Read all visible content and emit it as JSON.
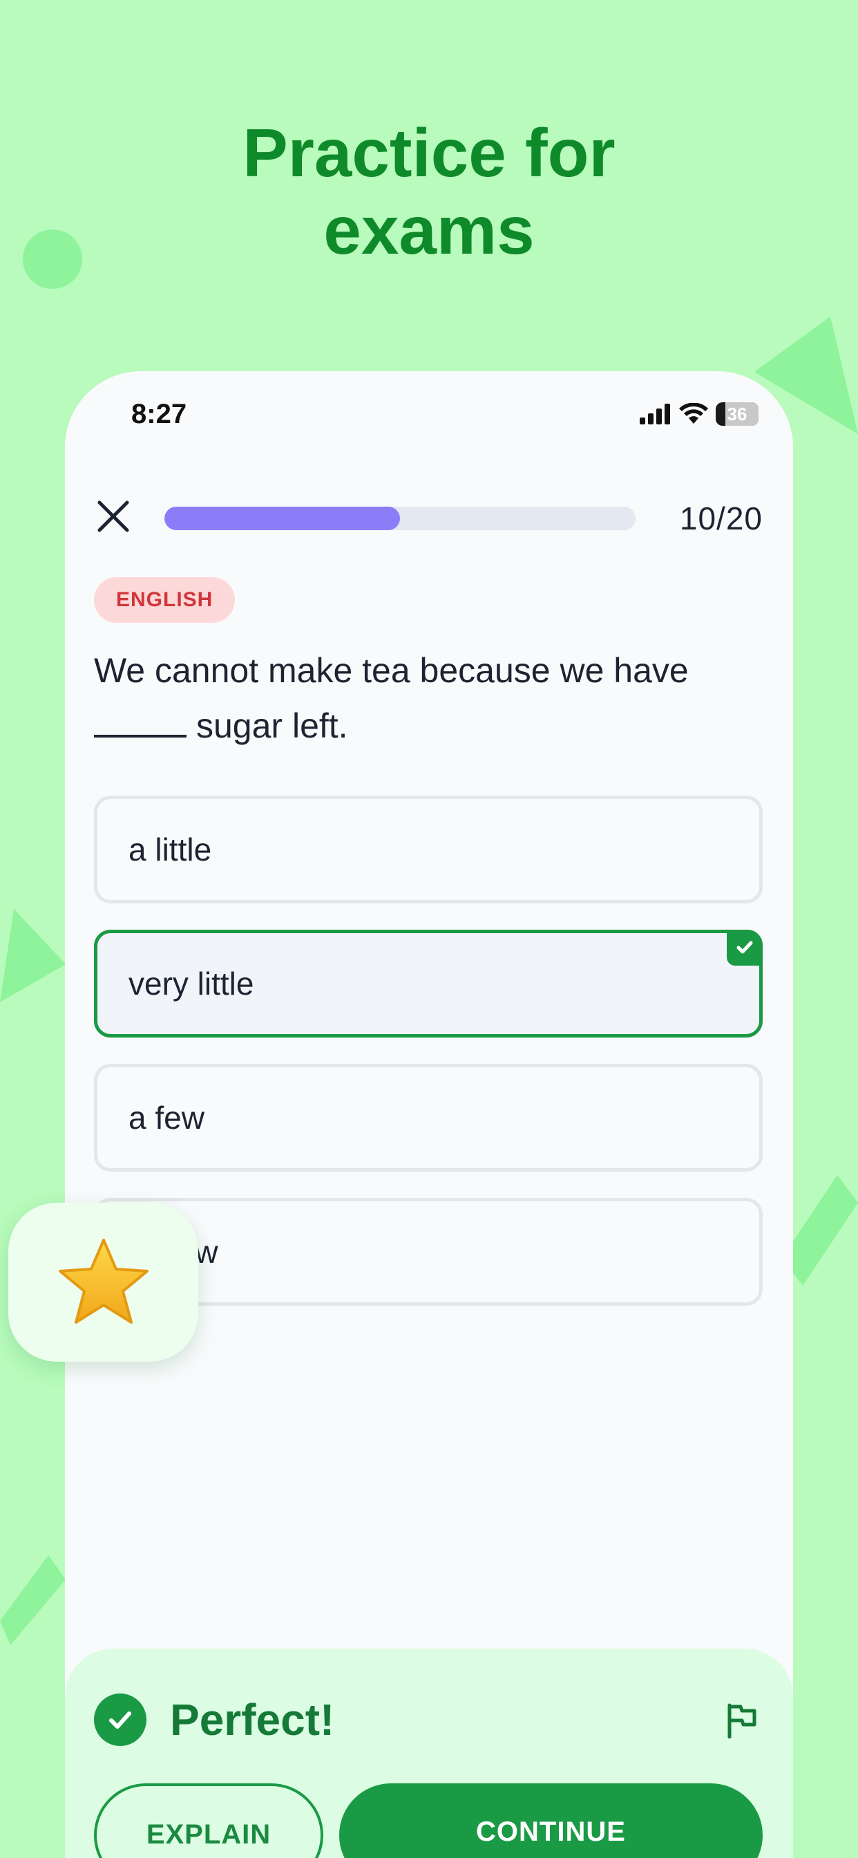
{
  "promo": {
    "headline_line1": "Practice for",
    "headline_line2": "exams"
  },
  "status_bar": {
    "time": "8:27",
    "battery": "36"
  },
  "quiz": {
    "progress_text": "10/20",
    "progress_fraction": 0.5,
    "subject": "ENGLISH",
    "question_before": "We cannot make tea because we have",
    "question_after": "sugar left.",
    "options": [
      {
        "label": "a little",
        "selected": false
      },
      {
        "label": "very little",
        "selected": true
      },
      {
        "label": "a few",
        "selected": false
      },
      {
        "label": "few",
        "selected": false
      }
    ]
  },
  "result": {
    "message": "Perfect!",
    "explain_label": "EXPLAIN",
    "continue_label": "CONTINUE"
  },
  "colors": {
    "background": "#b8fbbc",
    "headline": "#0f8a2a",
    "accent_green": "#1a9a45",
    "progress": "#8b7cf8",
    "subject_tag_bg": "#fcd9d8",
    "subject_tag_text": "#d0363a"
  },
  "icons": {
    "close": "close-icon",
    "flag": "flag-icon",
    "check": "check-icon",
    "star": "star-icon"
  }
}
